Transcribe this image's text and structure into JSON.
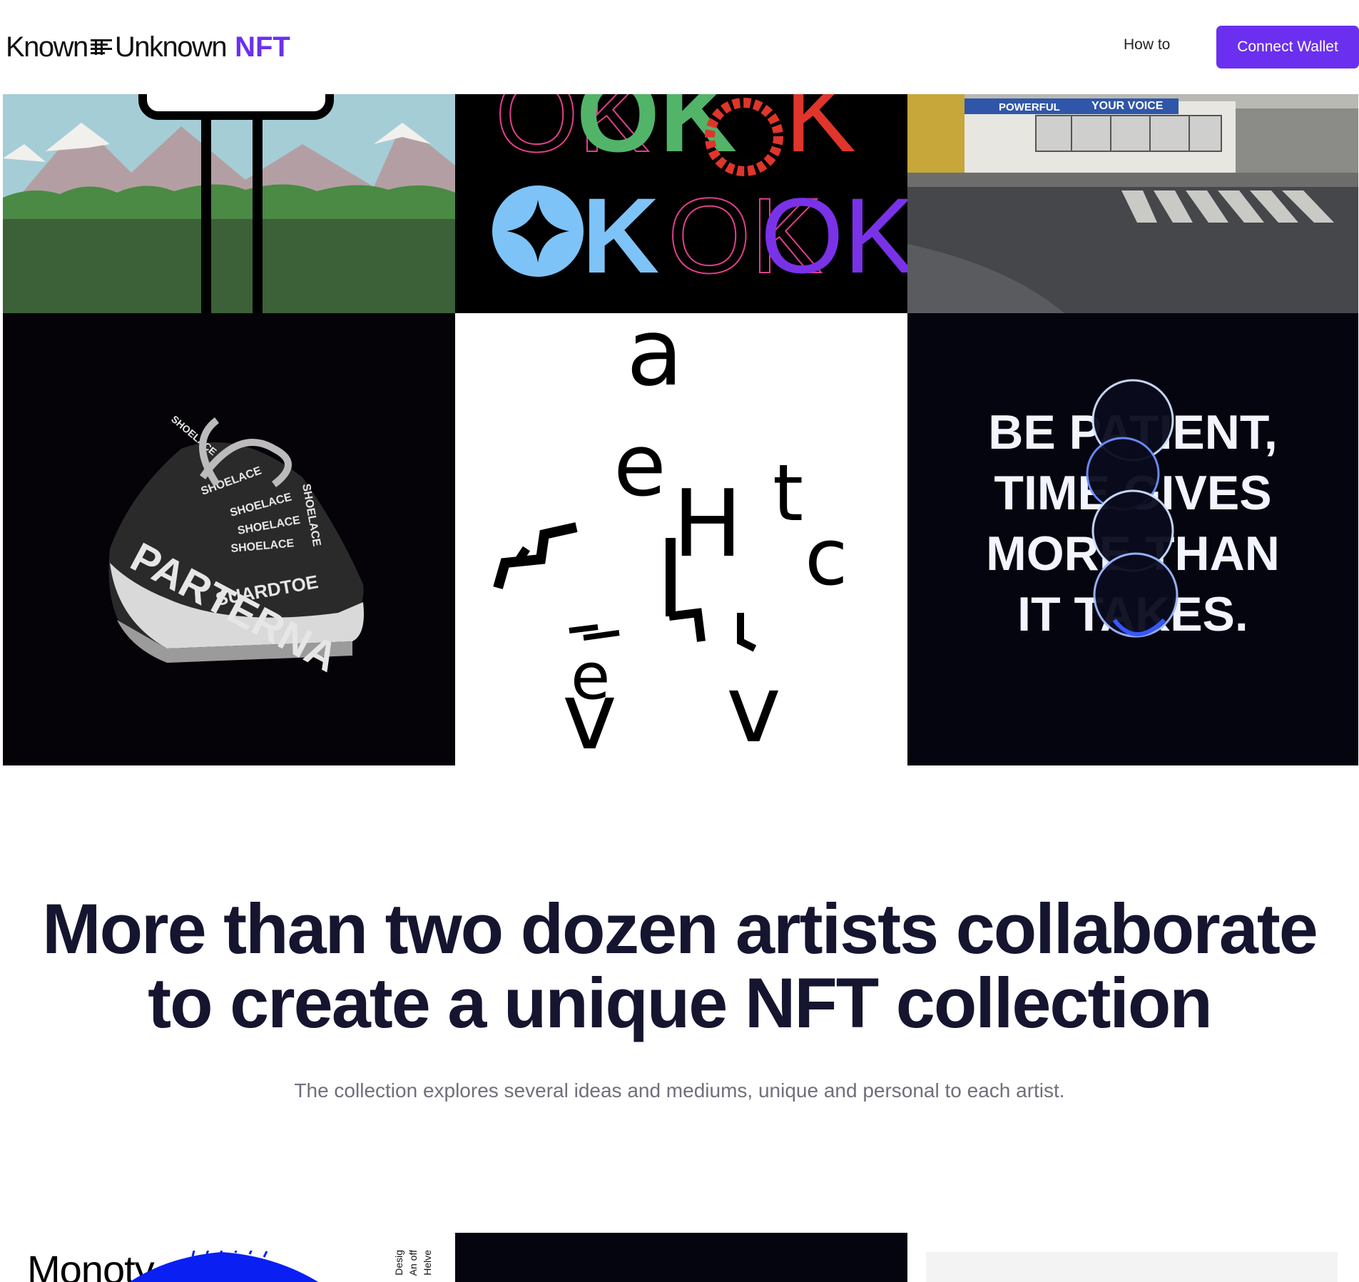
{
  "header": {
    "logo_known": "Known",
    "logo_unknown": "Unknown",
    "logo_nft": "NFT",
    "nav_how_to": "How to",
    "connect_wallet": "Connect Wallet"
  },
  "colors": {
    "brand_purple": "#6b2ff0",
    "headline": "#151530",
    "subtext": "#6f6f7c"
  },
  "gallery": {
    "street_sign_a": "POWERFUL",
    "street_sign_b": "YOUR VOICE",
    "ok_row1": [
      "OK",
      "OK",
      "O",
      "K"
    ],
    "ok_row2": [
      "OK",
      "OK",
      "OK"
    ],
    "shoe_words": [
      "SHOELACE",
      "SHOELACE",
      "SHOELACE",
      "SHOELACE",
      "SHOELACE",
      "SHOELACE"
    ],
    "shoe_lower": "SUARDTOE",
    "shoe_side": "PARTERNA",
    "letters": [
      "a",
      "e",
      "H",
      "t",
      "c",
      "v",
      "v",
      "e"
    ],
    "quote_lines": [
      "BE PATIENT,",
      "TIME GIVES",
      "MORE THAN",
      "IT TAKES."
    ]
  },
  "hero": {
    "headline_line1": "More than two dozen artists collaborate",
    "headline_line2": "to create a unique NFT collection",
    "subline": "The collection explores several ideas and mediums, unique and personal to each artist."
  },
  "bottom": {
    "mono_title": "Monoty",
    "vertical_lines": [
      "Helve",
      "An off",
      "Desig"
    ]
  }
}
